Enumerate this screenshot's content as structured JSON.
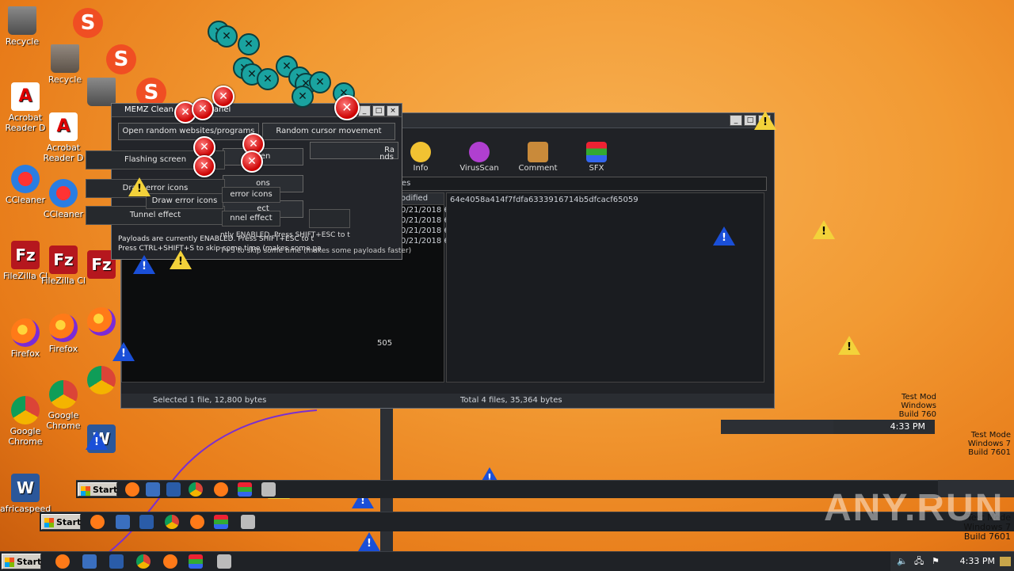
{
  "desktop": {
    "icons": [
      {
        "name": "recycle-bin",
        "label": "Recycle",
        "glyph": "bin"
      },
      {
        "name": "acrobat-reader",
        "label": "Acrobat Reader D",
        "glyph": "acro"
      },
      {
        "name": "ccleaner",
        "label": "CCleaner",
        "glyph": "ccl"
      },
      {
        "name": "filezilla",
        "label": "FileZilla Cl",
        "glyph": "fz"
      },
      {
        "name": "firefox",
        "label": "Firefox",
        "glyph": "ff"
      },
      {
        "name": "google-chrome",
        "label": "Google Chrome",
        "glyph": "chrome"
      },
      {
        "name": "africaspeed",
        "label": "africaspeed",
        "glyph": "word"
      }
    ],
    "s_logo_letter": "S"
  },
  "file_manager": {
    "toolbar": [
      {
        "label": "Info",
        "color": "#f1c232"
      },
      {
        "label": "VirusScan",
        "color": "#b03fd0"
      },
      {
        "label": "Comment",
        "color": "#c98a3a"
      },
      {
        "label": "SFX",
        "color": "#6d4fc7"
      }
    ],
    "address": "tes",
    "left_col_header": "odified",
    "left_rows": [
      "0/21/2018 6",
      "0/21/2018 6",
      "0/21/2018 6",
      "0/21/2018 6"
    ],
    "right_hash": "64e4058a414f7fdfa6333916714b5dfcacf65059",
    "status_left": "Selected 1 file, 12,800 bytes",
    "status_right": "Total 4 files, 35,364 bytes",
    "fragment": "505"
  },
  "memz_panel": {
    "title": "MEMZ Clean Payload Panel",
    "title_fragment": "ayload Panel",
    "buttons": {
      "open_random": "Open random websites/programs",
      "random_cursor": "Random cursor movement",
      "flashing_screen": "Flashing screen",
      "draw_error_icons": "Draw error icons",
      "tunnel_effect": "Tunnel effect",
      "ra": "Ra",
      "nds": "nds",
      "een": "een",
      "ons": "ons",
      "ect": "ect",
      "nnel_effect": "nnel effect",
      "error_icons": "error icons",
      "flashing_small": "Flashing",
      "draw_error_icons_small": "Draw error icons",
      "tunnel_small": "Tunnel effect"
    },
    "note1": "Payloads are currently ENABLED. Press SHIFT+ESC to t",
    "note2": "Press CTRL+SHIFT+S to skip some time (makes some pa",
    "note1_ghost": "ntly ENABLED. Press SHIFT+ESC to t",
    "note2_ghost": "T+S to skip some time (makes some payloads faster)"
  },
  "taskbar": {
    "start_label": "Start",
    "clock": "4:33 PM",
    "watermark": {
      "line1": "Test Mode",
      "line2": "Windows 7",
      "line3": "Build 7601"
    },
    "watermark_ghost": {
      "line1": "Test Mod",
      "line2": "Windows",
      "line3": "Build 760"
    }
  },
  "anyrun_logo": "ANY.RUN"
}
